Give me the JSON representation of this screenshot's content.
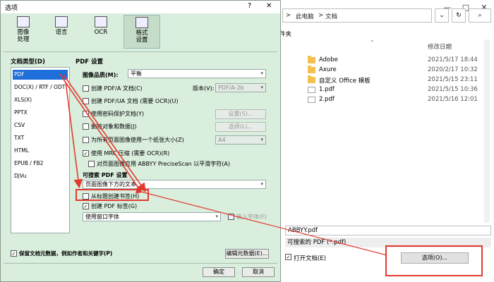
{
  "save_dialog": {
    "breadcrumb": [
      "此电脑",
      "文档"
    ],
    "breadcrumb_sep": ">",
    "left_label": "件夹",
    "column_date": "修改日期",
    "files": [
      {
        "name": "Adobe",
        "date": "2021/5/17 18:44",
        "type": "folder"
      },
      {
        "name": "Axure",
        "date": "2020/2/17 10:32",
        "type": "folder"
      },
      {
        "name": "自定义 Office 模板",
        "date": "2021/5/15 23:11",
        "type": "folder"
      },
      {
        "name": "1.pdf",
        "date": "2021/5/15 10:36",
        "type": "pdf"
      },
      {
        "name": "2.pdf",
        "date": "2021/5/16 12:01",
        "type": "pdf"
      }
    ],
    "filename": "ABBYY.pdf",
    "filetype": "可搜索的 PDF (*.pdf)",
    "open_doc_label": "打开文档(E)",
    "options_button": "选项(O)..."
  },
  "options_dialog": {
    "title": "选项",
    "help": "?",
    "close": "✕",
    "tabs": [
      {
        "label1": "图像",
        "label2": "处理"
      },
      {
        "label1": "语言",
        "label2": ""
      },
      {
        "label1": "OCR",
        "label2": ""
      },
      {
        "label1": "格式",
        "label2": "设置"
      }
    ],
    "doc_type_heading": "文档类型(D)",
    "doc_types": [
      "PDF",
      "DOC(X) / RTF / ODT",
      "XLS(X)",
      "PPTX",
      "CSV",
      "TXT",
      "HTML",
      "EPUB / FB2",
      "DjVu"
    ],
    "pdf_settings_heading": "PDF 设置",
    "image_quality_label": "图像品质(M):",
    "image_quality_value": "平衡",
    "pdfa_label": "创建 PDF/A 文档(C)",
    "version_label": "版本(V):",
    "version_value": "PDF/A-2b",
    "pdfua_label": "创建 PDF/UA 文档 (需要 OCR)(U)",
    "password_label": "使用密码保护文档(Y)",
    "settings_button": "设置(S)...",
    "delete_label": "删除对象和数据(J)",
    "select_button": "选择(L)...",
    "paper_label": "为所有页面图像使用一个纸张大小(Z)",
    "paper_value": "A4",
    "mrc_label": "使用 MRC 压缩 (需要 OCR)(R)",
    "precise_label": "对页面图像应用 ABBYY PreciseScan 以平滑字符(A)",
    "searchable_heading": "可搜索 PDF 设置",
    "searchable_value": "页面图像下方的文本",
    "bookmarks_label": "从标题创建书签(H)",
    "tags_label": "创建 PDF 标签(G)",
    "font_value": "使用窗口字体",
    "embed_label": "嵌入字体(F)",
    "metadata_label": "保留文档元数据，例如作者和关键字(P)",
    "edit_metadata_button": "编辑元数据(E)...",
    "ok_button": "确定",
    "cancel_button": "取消",
    "check_mark": "✓",
    "dropdown_arrow": "▾"
  },
  "colors": {
    "dialog_bg": "#d9eedd",
    "selection": "#1e6fd9",
    "annotation_red": "#e23a2f"
  }
}
